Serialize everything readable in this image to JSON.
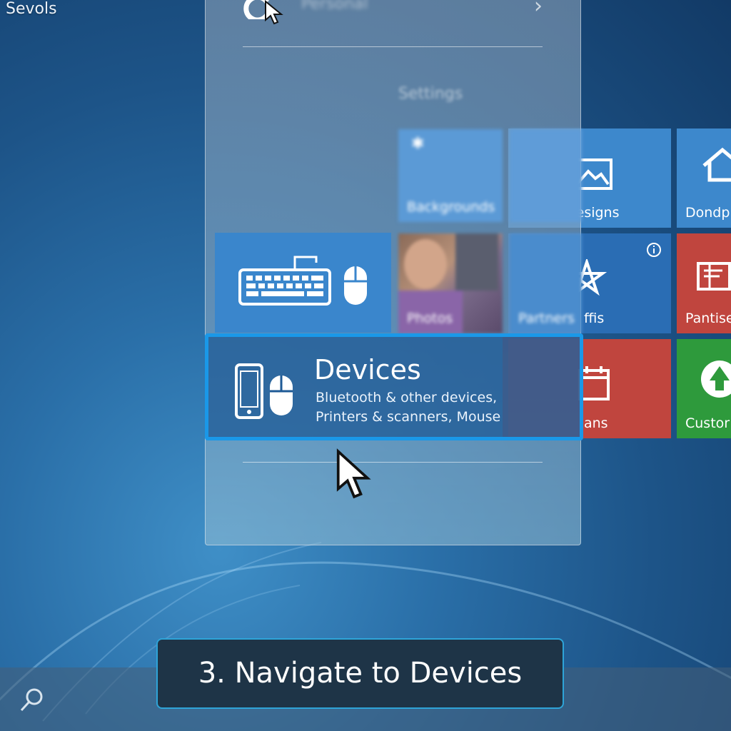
{
  "corner_title": "Sevols",
  "panel": {
    "top_item_name": "Personal",
    "section_heading": "Settings"
  },
  "tiles": {
    "tile_a_label": "Backgrounds",
    "tile_b_label": "Designs",
    "tile_c_label": "Dondp",
    "tile_photos_label": "Photos",
    "tile_d_label": "Partners",
    "tile_e_label": "ffis",
    "tile_f_label": "Pantise",
    "tile_g_label": "ans",
    "tile_h_label": "Custor"
  },
  "devices": {
    "title": "Devices",
    "line1": "Bluetooth & other devices,",
    "line2": "Printers & scanners, Mouse"
  },
  "step_caption": "3. Navigate to Devices",
  "colors": {
    "tile_blue": "#3d8ad0",
    "tile_red": "#c0453e",
    "tile_green": "#2e9a3c",
    "highlight_border": "#1a98e8"
  }
}
